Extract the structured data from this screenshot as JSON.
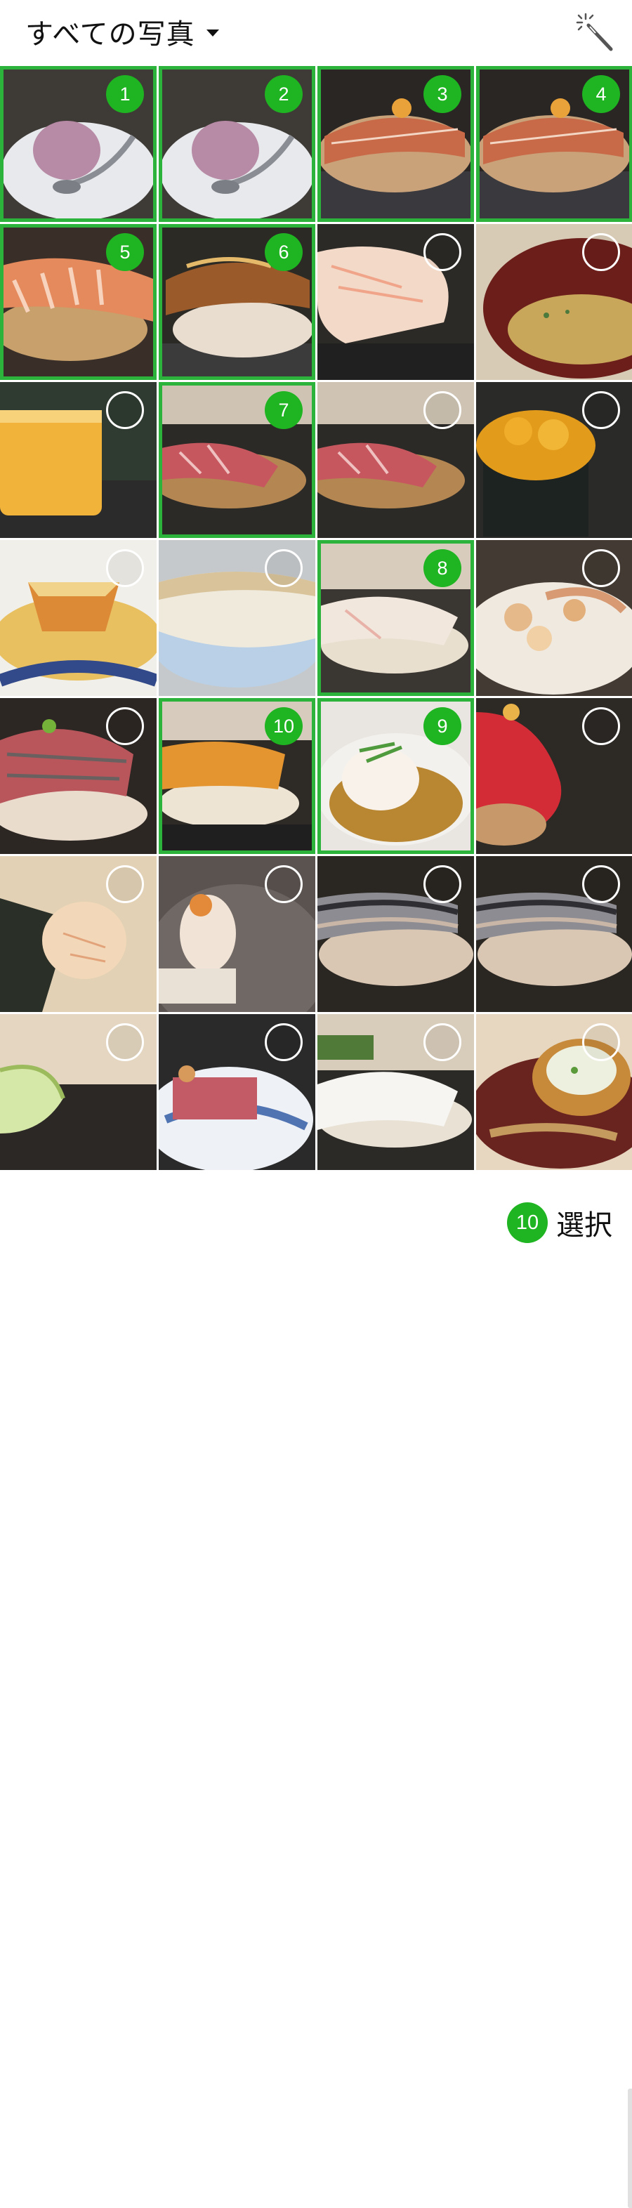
{
  "header": {
    "album_title": "すべての写真",
    "album_caret_icon": "caret-down-icon",
    "magic_icon": "magic-wand-icon"
  },
  "photos": [
    {
      "selected": true,
      "order": "1",
      "subject": "ice-cream-scoop"
    },
    {
      "selected": true,
      "order": "2",
      "subject": "ice-cream-scoop"
    },
    {
      "selected": true,
      "order": "3",
      "subject": "seared-nigiri"
    },
    {
      "selected": true,
      "order": "4",
      "subject": "seared-nigiri"
    },
    {
      "selected": true,
      "order": "5",
      "subject": "shrimp-nigiri"
    },
    {
      "selected": true,
      "order": "6",
      "subject": "eel-nigiri"
    },
    {
      "selected": false,
      "order": "",
      "subject": "white-shrimp-nigiri"
    },
    {
      "selected": false,
      "order": "",
      "subject": "miso-soup"
    },
    {
      "selected": false,
      "order": "",
      "subject": "tamago"
    },
    {
      "selected": true,
      "order": "7",
      "subject": "toro-nigiri"
    },
    {
      "selected": false,
      "order": "",
      "subject": "toro-nigiri"
    },
    {
      "selected": false,
      "order": "",
      "subject": "uni-gunkan"
    },
    {
      "selected": false,
      "order": "",
      "subject": "monkfish-liver"
    },
    {
      "selected": false,
      "order": "",
      "subject": "grilled-fish"
    },
    {
      "selected": true,
      "order": "8",
      "subject": "white-fish-nigiri"
    },
    {
      "selected": false,
      "order": "",
      "subject": "scallop-plate"
    },
    {
      "selected": false,
      "order": "",
      "subject": "aji-nigiri"
    },
    {
      "selected": true,
      "order": "10",
      "subject": "salmon-nigiri"
    },
    {
      "selected": true,
      "order": "9",
      "subject": "tofu-dish"
    },
    {
      "selected": false,
      "order": "",
      "subject": "tuna-nigiri"
    },
    {
      "selected": false,
      "order": "",
      "subject": "scallop-nori"
    },
    {
      "selected": false,
      "order": "",
      "subject": "white-nigiri-plate"
    },
    {
      "selected": false,
      "order": "",
      "subject": "kohada-nigiri"
    },
    {
      "selected": false,
      "order": "",
      "subject": "kohada-nigiri"
    },
    {
      "selected": false,
      "order": "",
      "subject": "pickled-vegetable"
    },
    {
      "selected": false,
      "order": "",
      "subject": "seared-bonito"
    },
    {
      "selected": false,
      "order": "",
      "subject": "squid-nigiri"
    },
    {
      "selected": false,
      "order": "",
      "subject": "chawanmushi"
    }
  ],
  "footer": {
    "selected_count": "10",
    "select_label": "選択"
  },
  "colors": {
    "accent": "#1fb421",
    "selection_border": "#2bb33b"
  }
}
